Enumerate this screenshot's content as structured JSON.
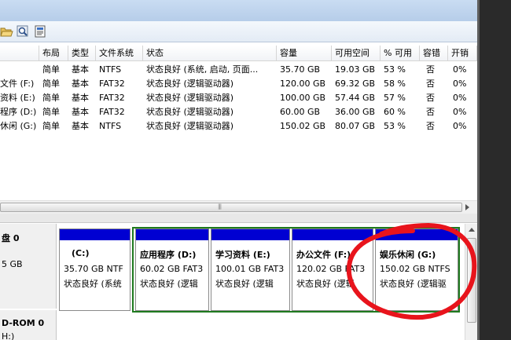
{
  "toolbar": {
    "icons": [
      "folder-open-icon",
      "magnifier-icon",
      "properties-icon"
    ]
  },
  "volume_table": {
    "headers": [
      "",
      "布局",
      "类型",
      "文件系统",
      "状态",
      "容量",
      "可用空间",
      "% 可用",
      "容错",
      "开销"
    ],
    "rows": [
      [
        "",
        "简单",
        "基本",
        "NTFS",
        "状态良好 (系统, 启动, 页面...",
        "35.70 GB",
        "19.03 GB",
        "53 %",
        "否",
        "0%"
      ],
      [
        "文件 (F:)",
        "简单",
        "基本",
        "FAT32",
        "状态良好 (逻辑驱动器)",
        "120.00 GB",
        "69.32 GB",
        "58 %",
        "否",
        "0%"
      ],
      [
        "资料 (E:)",
        "简单",
        "基本",
        "FAT32",
        "状态良好 (逻辑驱动器)",
        "100.00 GB",
        "57.44 GB",
        "57 %",
        "否",
        "0%"
      ],
      [
        "程序 (D:)",
        "简单",
        "基本",
        "FAT32",
        "状态良好 (逻辑驱动器)",
        "60.00 GB",
        "36.00 GB",
        "60 %",
        "否",
        "0%"
      ],
      [
        "休闲 (G:)",
        "简单",
        "基本",
        "NTFS",
        "状态良好 (逻辑驱动器)",
        "150.02 GB",
        "80.07 GB",
        "53 %",
        "否",
        "0%"
      ]
    ]
  },
  "disk0": {
    "name": "盘 0",
    "size": "5 GB",
    "partitions": [
      {
        "name": "(C:)",
        "size": "35.70 GB NTF",
        "status": "状态良好 (系统"
      },
      {
        "name": "应用程序  (D:)",
        "size": "60.02 GB FAT3",
        "status": "状态良好 (逻辑"
      },
      {
        "name": "学习资料  (E:)",
        "size": "100.01 GB FAT3",
        "status": "状态良好 (逻辑"
      },
      {
        "name": "办公文件  (F:)",
        "size": "120.02 GB FAT3",
        "status": "状态良好 (逻辑"
      },
      {
        "name": "娱乐休闲  (G:)",
        "size": "150.02 GB NTFS",
        "status": "状态良好 (逻辑驱"
      }
    ]
  },
  "cdrom": {
    "name": "D-ROM 0",
    "sub": "H:)"
  },
  "colors": {
    "primary_partition_bar": "#0000d2",
    "extended_partition_frame": "#1f7a1f",
    "annotation": "#e8141c"
  }
}
